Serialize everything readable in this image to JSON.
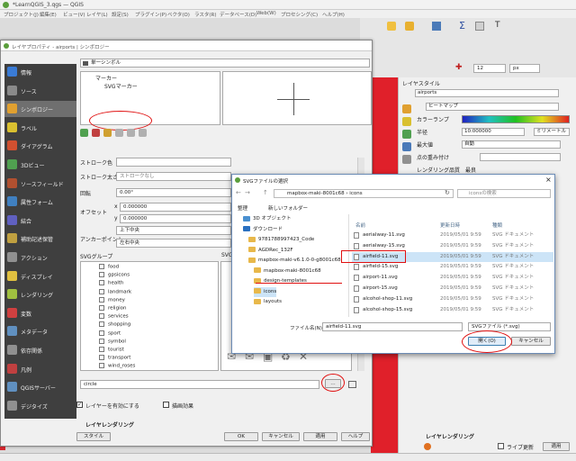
{
  "window": {
    "title": "*LearnQGIS_3.qgs — QGIS"
  },
  "menubar": [
    "プロジェクト(J)",
    "編集(E)",
    "ビュー(V)",
    "レイヤ(L)",
    "設定(S)",
    "プラグイン(P)",
    "ベクタ(O)",
    "ラスタ(R)",
    "データベース(D)",
    "Web(W)",
    "プロセシング(C)",
    "ヘルプ(H)"
  ],
  "props_dialog": {
    "title": "レイヤプロパティ - airports | シンボロジー",
    "sidebar": [
      {
        "label": "情報",
        "color": "#3a7bd5"
      },
      {
        "label": "ソース",
        "color": "#8a8a8a"
      },
      {
        "label": "シンボロジー",
        "color": "#e0a030"
      },
      {
        "label": "ラベル",
        "color": "#d9c030"
      },
      {
        "label": "ダイアグラム",
        "color": "#d05030"
      },
      {
        "label": "3Dビュー",
        "color": "#50a050"
      },
      {
        "label": "ソースフィールド",
        "color": "#b05030"
      },
      {
        "label": "属性フォーム",
        "color": "#4080c0"
      },
      {
        "label": "結合",
        "color": "#6060c0"
      },
      {
        "label": "補助記述保管",
        "color": "#c0a040"
      },
      {
        "label": "アクション",
        "color": "#909090"
      },
      {
        "label": "ディスプレイ",
        "color": "#e0c040"
      },
      {
        "label": "レンダリング",
        "color": "#a0c040"
      },
      {
        "label": "変数",
        "color": "#d04040"
      },
      {
        "label": "メタデータ",
        "color": "#6090c0"
      },
      {
        "label": "依存関係",
        "color": "#909090"
      },
      {
        "label": "凡例",
        "color": "#c04040"
      },
      {
        "label": "QGISサーバー",
        "color": "#6090c0"
      },
      {
        "label": "デジタイズ",
        "color": "#909090"
      }
    ],
    "renderer": "単一シンボル",
    "symbol_tree": [
      "マーカー",
      "SVGマーカー"
    ],
    "stroke_color_label": "ストローク色",
    "stroke_width_label": "ストローク太さ",
    "stroke_width_value": "ストロークなし",
    "rotation_label": "回転",
    "rotation_value": "0.00°",
    "offset_label": "オフセット",
    "offset_x_label": "x",
    "offset_y_label": "y",
    "offset_x": "0.000000",
    "offset_y": "0.000000",
    "anchor_label": "アンカーポイント",
    "anchor_h": "上下中央",
    "anchor_v": "左右中央",
    "svg_group_label": "SVGグループ",
    "svg_images_label": "SVG",
    "svg_groups": [
      "food",
      "gpsicons",
      "health",
      "landmark",
      "money",
      "religion",
      "services",
      "shopping",
      "sport",
      "symbol",
      "tourist",
      "transport",
      "wind_roses"
    ],
    "svg_path": "circle",
    "layer_render_checkbox": "レイヤーを有効にする",
    "draw_effects": "描画効果",
    "layer_rendering": "レイヤレンダリング",
    "style_btn": "スタイル",
    "ok": "OK",
    "cancel": "キャンセル",
    "apply": "適用",
    "help": "ヘルプ"
  },
  "layer_style": {
    "title": "レイヤスタイル",
    "layer": "airports",
    "renderer": "ヒートマップ",
    "color_ramp_label": "カラーランプ",
    "radius_label": "半径",
    "radius_value": "10.000000",
    "radius_unit": "ミリメートル",
    "max_label": "最大値",
    "max_value": "自動",
    "weight_label": "点の重み付け",
    "render_quality_label": "レンダリング品質",
    "render_quality_value": "最良",
    "layer_rendering": "レイヤレンダリング",
    "live_update": "ライブ更新",
    "apply": "適用"
  },
  "file_dialog": {
    "title": "SVGファイルの選択",
    "breadcrumb": [
      "mapbox-maki-8001c68",
      "icons"
    ],
    "search_placeholder": "iconsの検索",
    "organize": "整理",
    "new_folder": "新しいフォルダー",
    "col_name": "名前",
    "col_date": "更新日時",
    "col_type": "種類",
    "tree": [
      {
        "label": "3D オブジェクト",
        "indent": 1
      },
      {
        "label": "ダウンロード",
        "indent": 1
      },
      {
        "label": "9781788997423_Code",
        "indent": 2
      },
      {
        "label": "AGDRec_132F",
        "indent": 2
      },
      {
        "label": "mapbox-maki-v6.1.0-0-g8001c68",
        "indent": 2
      },
      {
        "label": "mapbox-maki-8001c68",
        "indent": 3
      },
      {
        "label": "design-templates",
        "indent": 3
      },
      {
        "label": "icons",
        "indent": 3
      },
      {
        "label": "layouts",
        "indent": 3
      }
    ],
    "files": [
      {
        "name": "aerialway-11.svg",
        "date": "2019/05/01 9:59",
        "type": "SVG ドキュメント"
      },
      {
        "name": "aerialway-15.svg",
        "date": "2019/05/01 9:59",
        "type": "SVG ドキュメント"
      },
      {
        "name": "airfield-11.svg",
        "date": "2019/05/01 9:59",
        "type": "SVG ドキュメント"
      },
      {
        "name": "airfield-15.svg",
        "date": "2019/05/01 9:59",
        "type": "SVG ドキュメント"
      },
      {
        "name": "airport-11.svg",
        "date": "2019/05/01 9:59",
        "type": "SVG ドキュメント"
      },
      {
        "name": "airport-15.svg",
        "date": "2019/05/01 9:59",
        "type": "SVG ドキュメント"
      },
      {
        "name": "alcohol-shop-11.svg",
        "date": "2019/05/01 9:59",
        "type": "SVG ドキュメント"
      },
      {
        "name": "alcohol-shop-15.svg",
        "date": "2019/05/01 9:59",
        "type": "SVG ドキュメント"
      }
    ],
    "filename_label": "ファイル名(N):",
    "filename_value": "airfield-11.svg",
    "filetype_value": "SVGファイル (*.svg)",
    "open_btn": "開く(O)",
    "cancel_btn": "キャンセル"
  },
  "toolbar": {
    "zoom_value": "12",
    "unit": "px"
  },
  "colors": {
    "accent": "#e01010",
    "selection": "#cce4f7",
    "sidebar": "#3f3f3f"
  }
}
